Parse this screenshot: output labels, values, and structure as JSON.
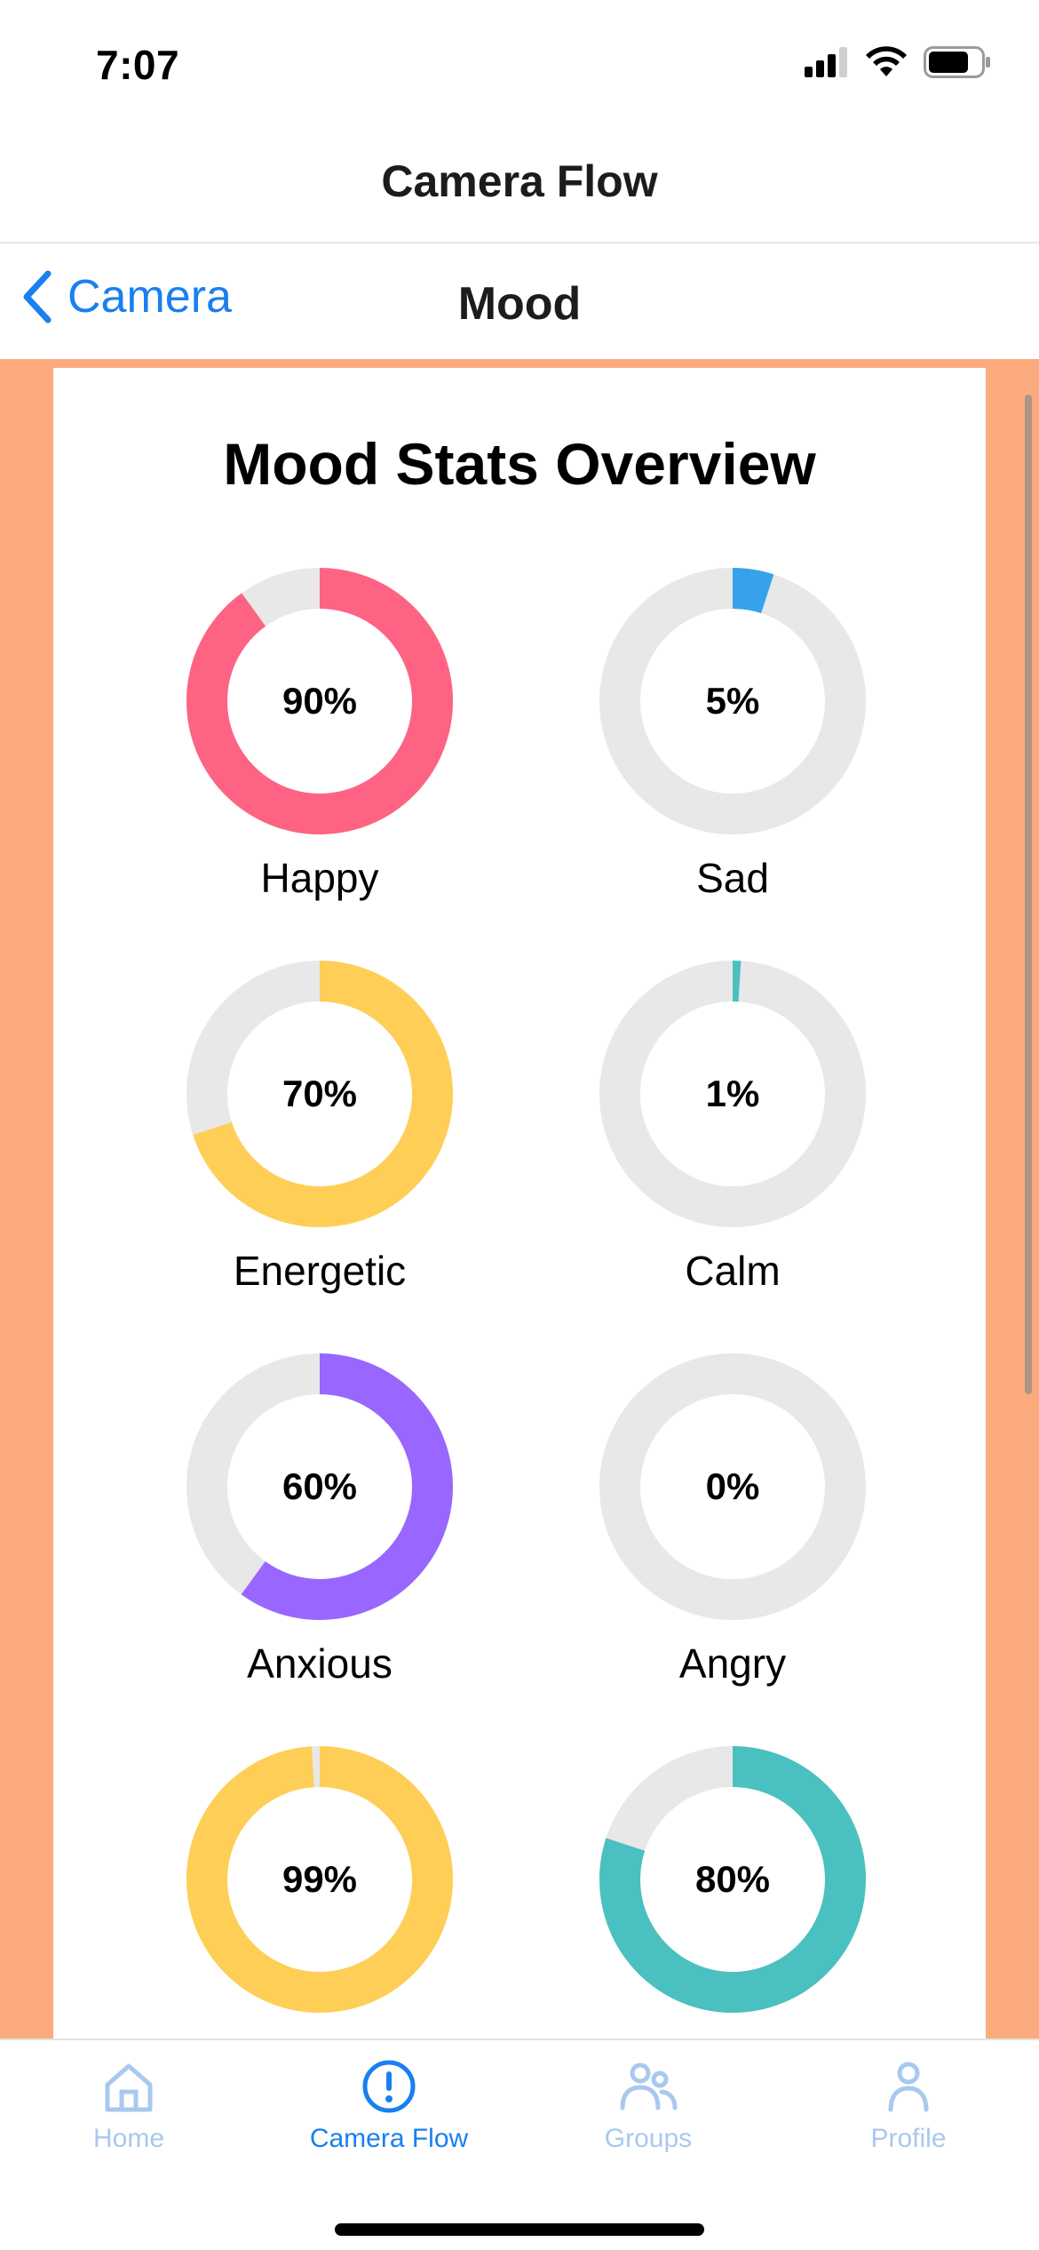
{
  "status": {
    "time": "7:07"
  },
  "app": {
    "title": "Camera Flow"
  },
  "nav": {
    "back_label": "Camera",
    "title": "Mood"
  },
  "card": {
    "title": "Mood Stats Overview"
  },
  "moods": [
    {
      "label": "Happy",
      "value": 90,
      "display": "90%",
      "color": "#ff6384"
    },
    {
      "label": "Sad",
      "value": 5,
      "display": "5%",
      "color": "#36a2eb"
    },
    {
      "label": "Energetic",
      "value": 70,
      "display": "70%",
      "color": "#ffce56"
    },
    {
      "label": "Calm",
      "value": 1,
      "display": "1%",
      "color": "#4bc0c0"
    },
    {
      "label": "Anxious",
      "value": 60,
      "display": "60%",
      "color": "#9966ff"
    },
    {
      "label": "Angry",
      "value": 0,
      "display": "0%",
      "color": "#ff6384"
    },
    {
      "label": "",
      "value": 99,
      "display": "99%",
      "color": "#ffce56"
    },
    {
      "label": "",
      "value": 80,
      "display": "80%",
      "color": "#4bc0c0"
    }
  ],
  "ring_track_color": "#e8e8e8",
  "tabs": [
    {
      "label": "Home",
      "icon": "home-icon",
      "active": false
    },
    {
      "label": "Camera Flow",
      "icon": "alert-circle-icon",
      "active": true
    },
    {
      "label": "Groups",
      "icon": "groups-icon",
      "active": false
    },
    {
      "label": "Profile",
      "icon": "profile-icon",
      "active": false
    }
  ],
  "colors": {
    "accent": "#1a7ff0",
    "background": "#fcab7e",
    "tab_inactive": "#a9c8ef"
  }
}
